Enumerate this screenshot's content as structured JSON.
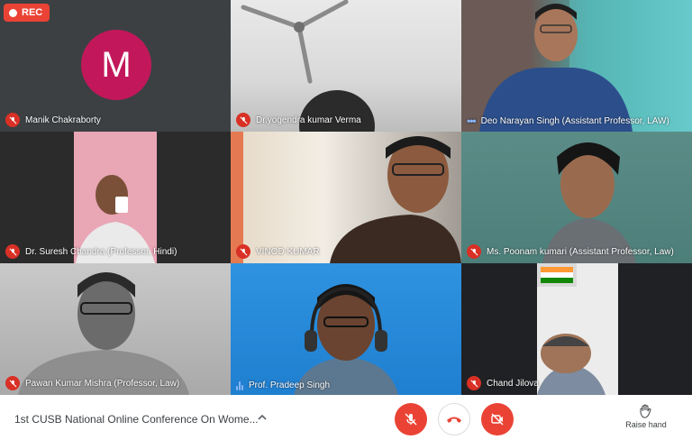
{
  "recording": {
    "label": "REC"
  },
  "participants": [
    {
      "name": "Manik Chakraborty",
      "muted": true,
      "avatar_letter": "M",
      "avatar_color": "#c2185b"
    },
    {
      "name": "Dr.yogendra kumar Verma",
      "muted": true
    },
    {
      "name": "Deo Narayan Singh (Assistant Professor, LAW)",
      "muted": false,
      "indicator": "more-dots"
    },
    {
      "name": "Dr. Suresh Chandra (Professor, Hindi)",
      "muted": true
    },
    {
      "name": "VINOD KUMAR",
      "muted": true
    },
    {
      "name": "Ms. Poonam kumari (Assistant Professor, Law)",
      "muted": true
    },
    {
      "name": "Pawan Kumar Mishra (Professor, Law)",
      "muted": true
    },
    {
      "name": "Prof. Pradeep Singh",
      "muted": false,
      "indicator": "speaking"
    },
    {
      "name": "Chand Jilova",
      "muted": true
    }
  ],
  "bottom_bar": {
    "meeting_title": "1st CUSB National Online Conference On Wome...",
    "raise_hand_label": "Raise hand"
  },
  "colors": {
    "mute_red": "#d93025",
    "control_red": "#ea4335",
    "accent_blue": "#8ab4f8"
  },
  "icons": [
    "mic-off-icon",
    "hangup-icon",
    "camera-off-icon",
    "raise-hand-icon",
    "chevron-up-icon"
  ]
}
